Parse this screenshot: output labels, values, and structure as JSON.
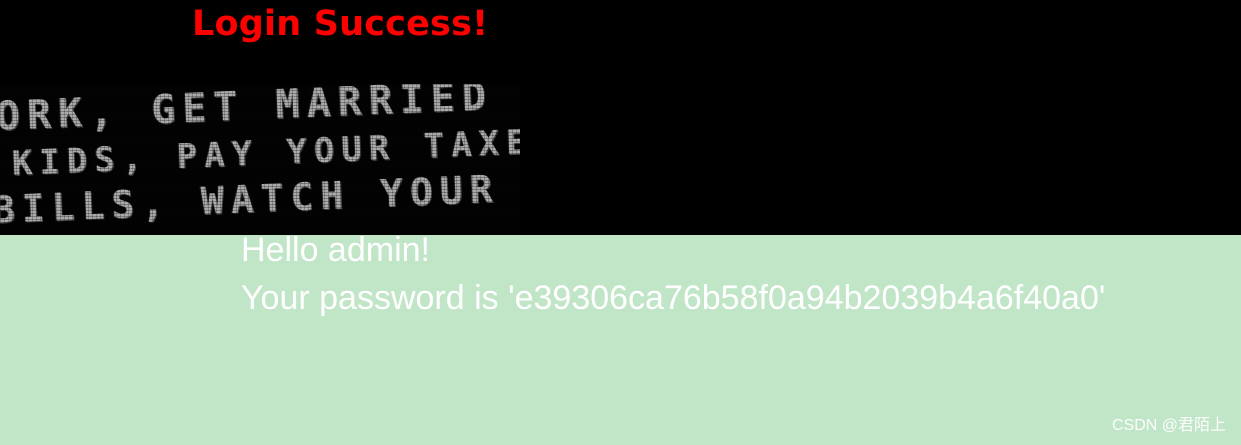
{
  "page": {
    "title": "Login Success!",
    "title_color": "#ff0000",
    "top_background": "#000000",
    "bottom_background": "#c0e5c7"
  },
  "poster": {
    "lines": [
      "ORK, GET MARRIED",
      "KIDS, PAY YOUR TAXES",
      "BILLS, WATCH YOUR TV"
    ]
  },
  "message": {
    "greeting": "Hello admin!",
    "password_text": "Your password is 'e39306ca76b58f0a94b2039b4a6f40a0'"
  },
  "watermark": {
    "text": "CSDN @君陌上"
  }
}
